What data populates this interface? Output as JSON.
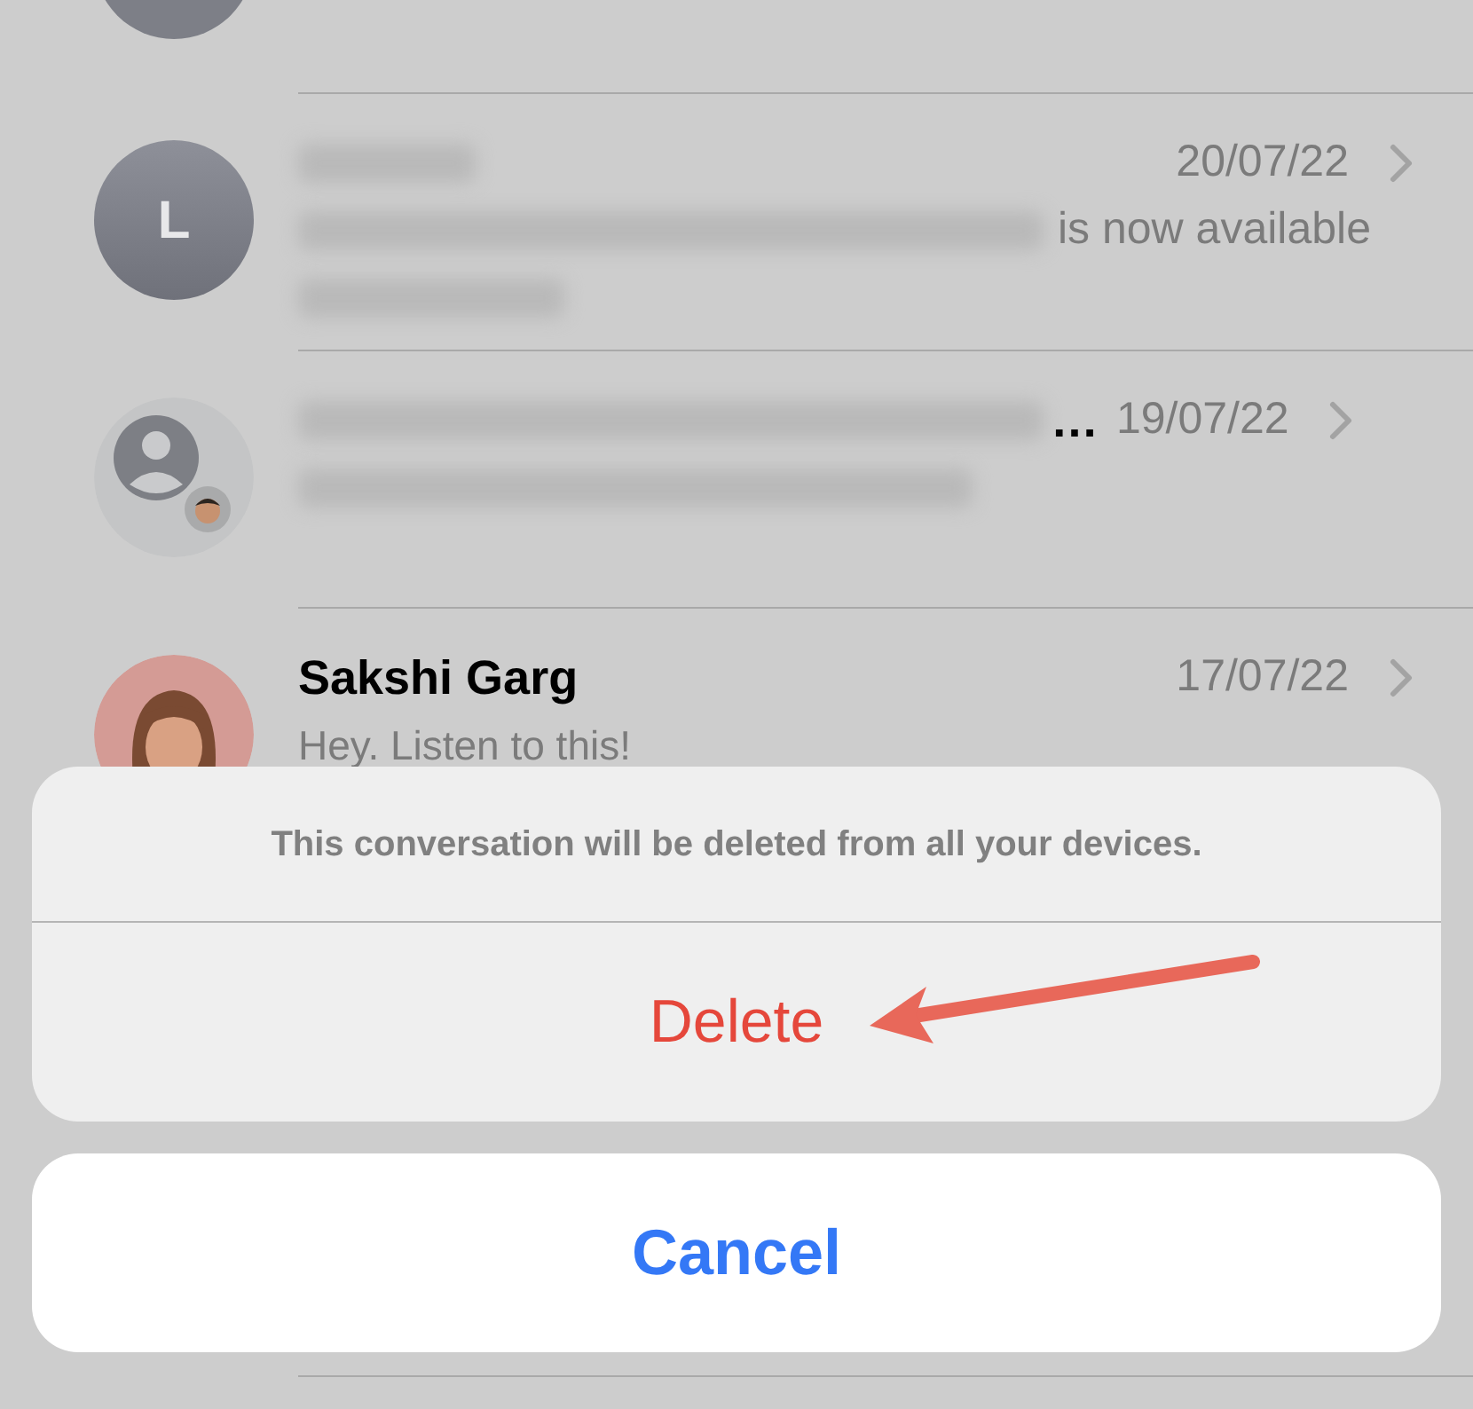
{
  "conversations": [
    {
      "kind": "redacted",
      "avatar": {
        "kind": "initial",
        "initial": "L"
      },
      "preview_end": "is now available",
      "date": "20/07/22"
    },
    {
      "kind": "redacted",
      "avatar": {
        "kind": "group"
      },
      "name_end": "…",
      "date": "19/07/22"
    },
    {
      "kind": "contact",
      "avatar": {
        "kind": "memoji"
      },
      "name": "Sakshi Garg",
      "preview": "Hey. Listen to this!",
      "date": "17/07/22"
    }
  ],
  "action_sheet": {
    "message": "This conversation will be deleted from all your devices.",
    "actions": [
      {
        "label": "Delete",
        "kind": "destructive"
      }
    ],
    "cancel": "Cancel"
  }
}
